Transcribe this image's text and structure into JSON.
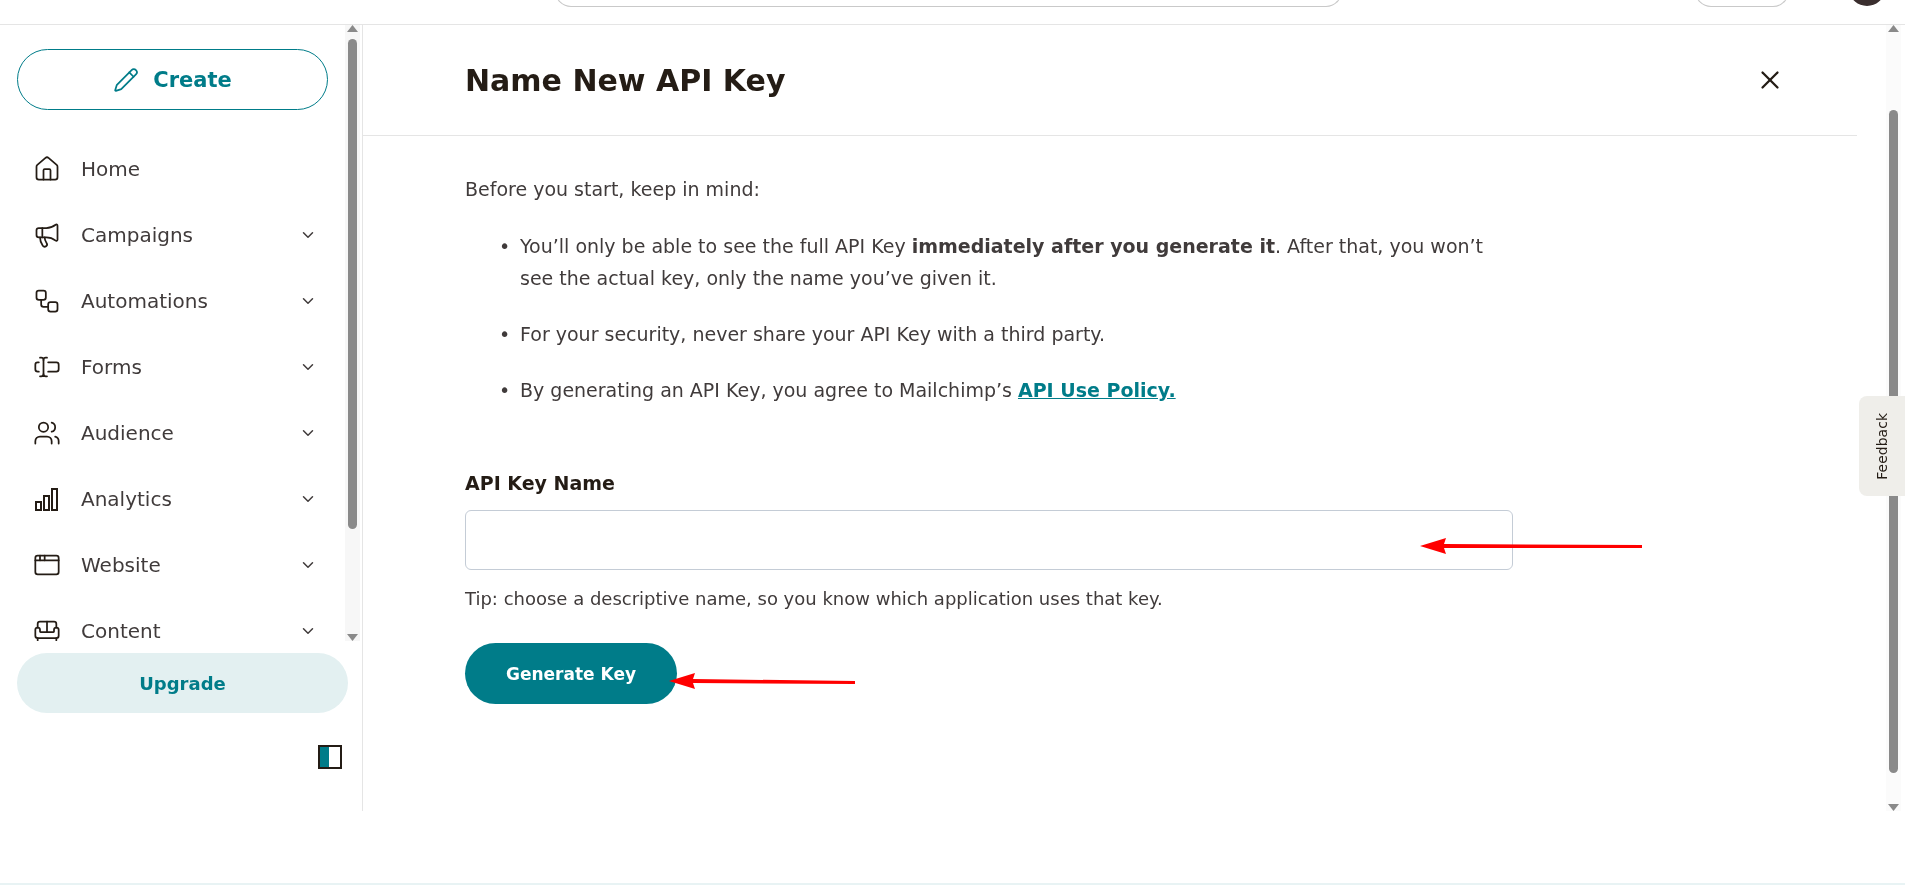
{
  "sidebar": {
    "create_button": "Create",
    "items": [
      {
        "label": "Home",
        "expandable": false
      },
      {
        "label": "Campaigns",
        "expandable": true
      },
      {
        "label": "Automations",
        "expandable": true
      },
      {
        "label": "Forms",
        "expandable": true
      },
      {
        "label": "Audience",
        "expandable": true
      },
      {
        "label": "Analytics",
        "expandable": true
      },
      {
        "label": "Website",
        "expandable": true
      },
      {
        "label": "Content",
        "expandable": true
      }
    ],
    "upgrade_button": "Upgrade"
  },
  "modal": {
    "title": "Name New API Key",
    "intro": "Before you start, keep in mind:",
    "bullets": [
      {
        "marker": "•",
        "text": "You’ll only be able to see the full API Key **immediately after you generate it**. After that, you won’t see the actual key, only the name you’ve given it."
      },
      {
        "marker": "•",
        "text": "For your security, never share your API Key with a third party."
      },
      {
        "marker": "•",
        "text": "By generating an API Key, you agree to Mailchimp’s",
        "link": "API Use Policy."
      }
    ],
    "field_label": "API Key Name",
    "tip": "Tip: choose a descriptive name, so you know which application uses that key.",
    "submit_button": "Generate Key"
  },
  "feedback_tab": "Feedback"
}
